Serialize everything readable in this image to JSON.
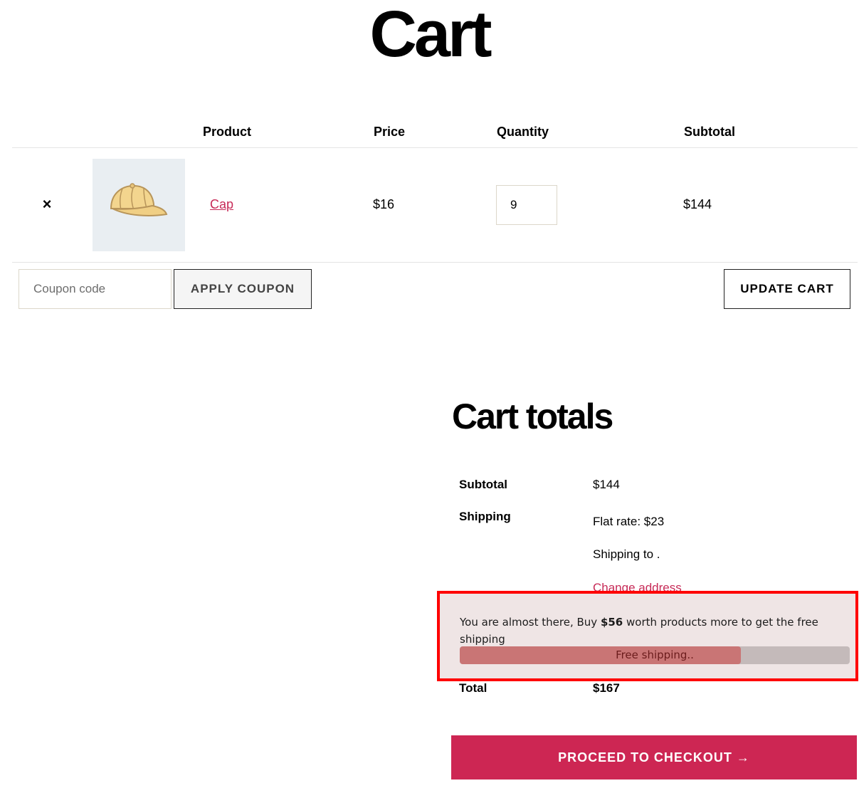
{
  "page": {
    "title": "Cart"
  },
  "table": {
    "headers": {
      "product": "Product",
      "price": "Price",
      "quantity": "Quantity",
      "subtotal": "Subtotal"
    },
    "rows": [
      {
        "remove": "×",
        "image_icon": "cap-icon",
        "product": "Cap",
        "price": "$16",
        "quantity": "9",
        "subtotal": "$144"
      }
    ]
  },
  "actions": {
    "coupon_placeholder": "Coupon code",
    "apply_coupon": "APPLY COUPON",
    "update_cart": "UPDATE CART"
  },
  "totals": {
    "title": "Cart totals",
    "subtotal_label": "Subtotal",
    "subtotal_value": "$144",
    "shipping_label": "Shipping",
    "shipping_method": "Flat rate: $23",
    "shipping_to": "Shipping to .",
    "change_address": "Change address",
    "total_label": "Total",
    "total_value": "$167"
  },
  "free_shipping_notice": {
    "text_before": "You are almost there, Buy ",
    "amount": "$56",
    "text_after": " worth products more to get the free shipping",
    "bar_label": "Free shipping..",
    "progress_fraction": 0.72,
    "highlight_color": "#ff0000"
  },
  "checkout": {
    "label": "PROCEED TO CHECKOUT →",
    "color": "#cd2653"
  },
  "colors": {
    "accent": "#cd2653",
    "link": "#c72a57"
  }
}
